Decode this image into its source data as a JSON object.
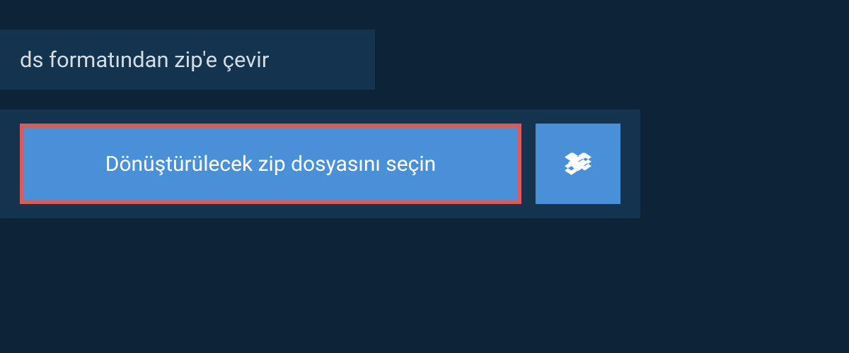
{
  "title": "ds formatından zip'e çevir",
  "select_file_label": "Dönüştürülecek zip dosyasını seçin",
  "colors": {
    "background": "#0d2438",
    "panel": "#13334f",
    "button": "#4a90d9",
    "highlight_border": "#db5a5a",
    "text_light": "#d5dde3",
    "text_white": "#ffffff"
  }
}
